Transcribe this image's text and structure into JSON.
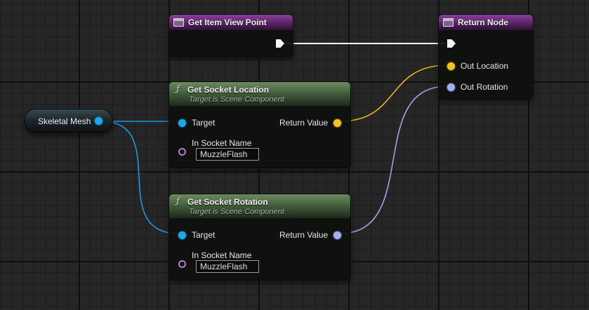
{
  "nodes": {
    "view_point": {
      "title": "Get Item View Point"
    },
    "return": {
      "title": "Return Node",
      "pins": {
        "out_location": "Out Location",
        "out_rotation": "Out Rotation"
      }
    },
    "socket_location": {
      "title": "Get Socket Location",
      "subtitle": "Target is Scene Component",
      "target_label": "Target",
      "return_label": "Return Value",
      "socket_label": "In Socket Name",
      "socket_value": "MuzzleFlash"
    },
    "socket_rotation": {
      "title": "Get Socket Rotation",
      "subtitle": "Target is Scene Component",
      "target_label": "Target",
      "return_label": "Return Value",
      "socket_label": "In Socket Name",
      "socket_value": "MuzzleFlash"
    },
    "skeletal_mesh": {
      "label": "Skeletal Mesh"
    }
  },
  "icons": {
    "function": "ƒ",
    "event": "event-icon",
    "exec": "exec-pin"
  },
  "colors": {
    "object_pin": "#1ea6ee",
    "vector_pin": "#f5c226",
    "rotator_pin": "#a4b0ee",
    "name_pin": "#b07fd0",
    "exec_wire": "#ffffff",
    "event_header": "#5a2468",
    "function_header": "#3c5636"
  }
}
